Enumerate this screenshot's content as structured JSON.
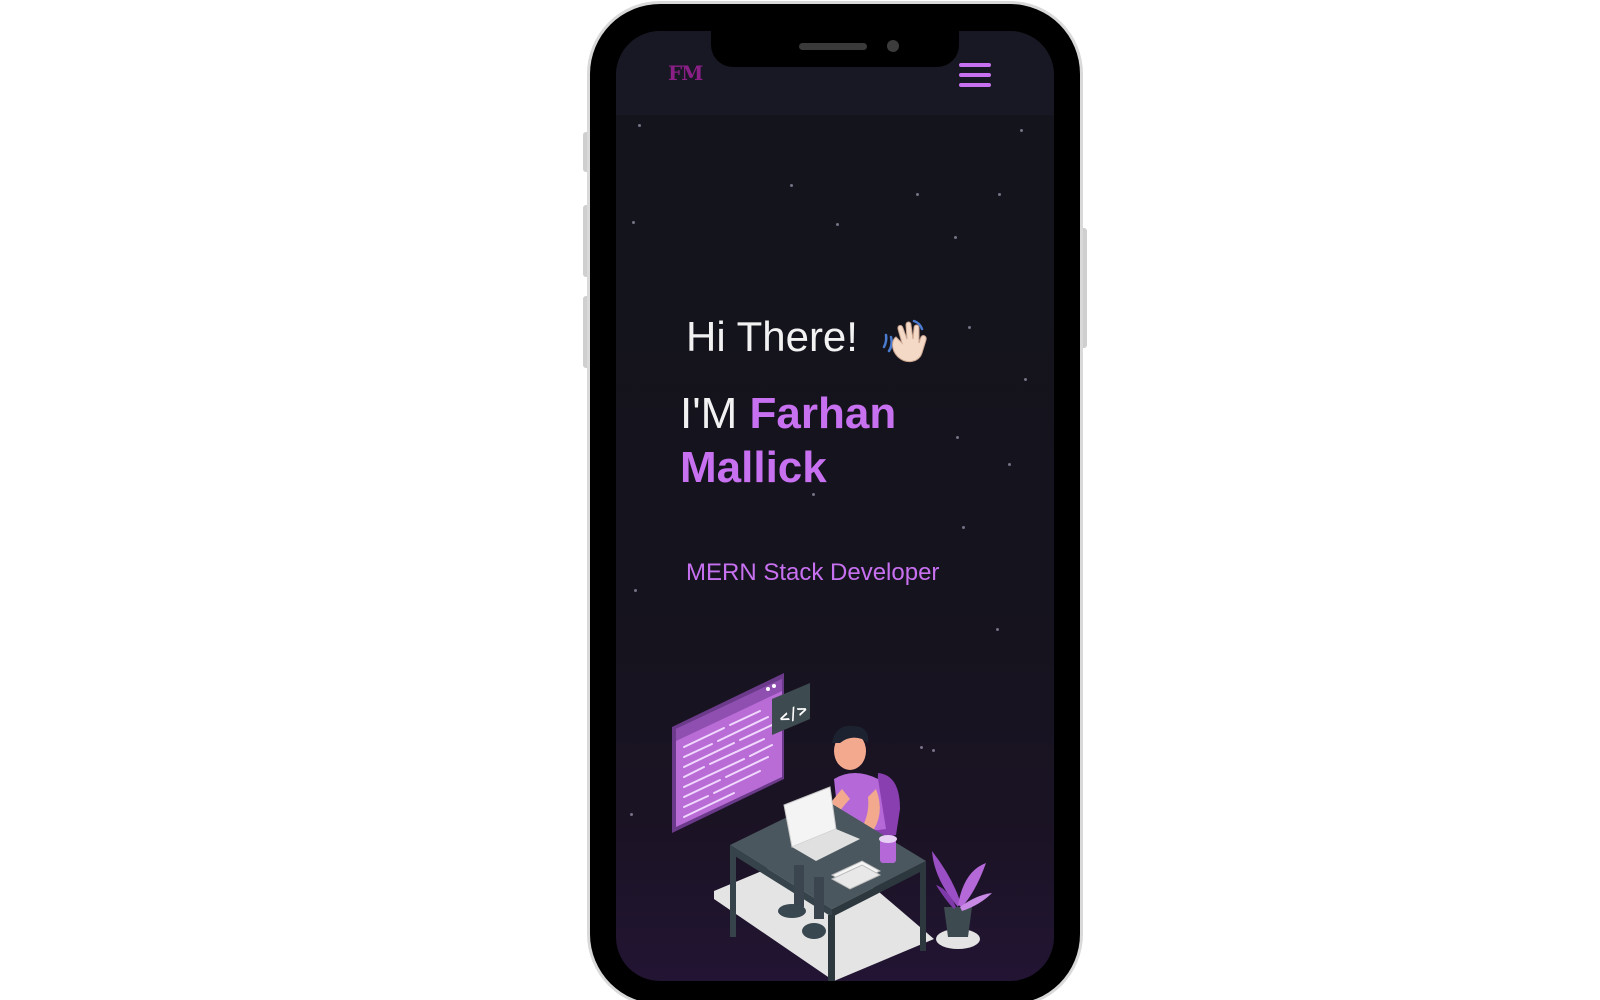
{
  "header": {
    "logo_text": "FM",
    "menu_icon": "hamburger-menu-icon"
  },
  "hero": {
    "greeting": "Hi There!",
    "wave_icon": "waving-hand-icon",
    "intro_prefix": "I'M",
    "name": "Farhan Mallick",
    "role": "MERN Stack Developer",
    "illustration": "developer-at-desk-illustration",
    "code_badge": "</>"
  },
  "colors": {
    "accent": "#c770f0",
    "logo": "#8a1f86",
    "background": "#14141c",
    "text": "#f2f2f2"
  }
}
